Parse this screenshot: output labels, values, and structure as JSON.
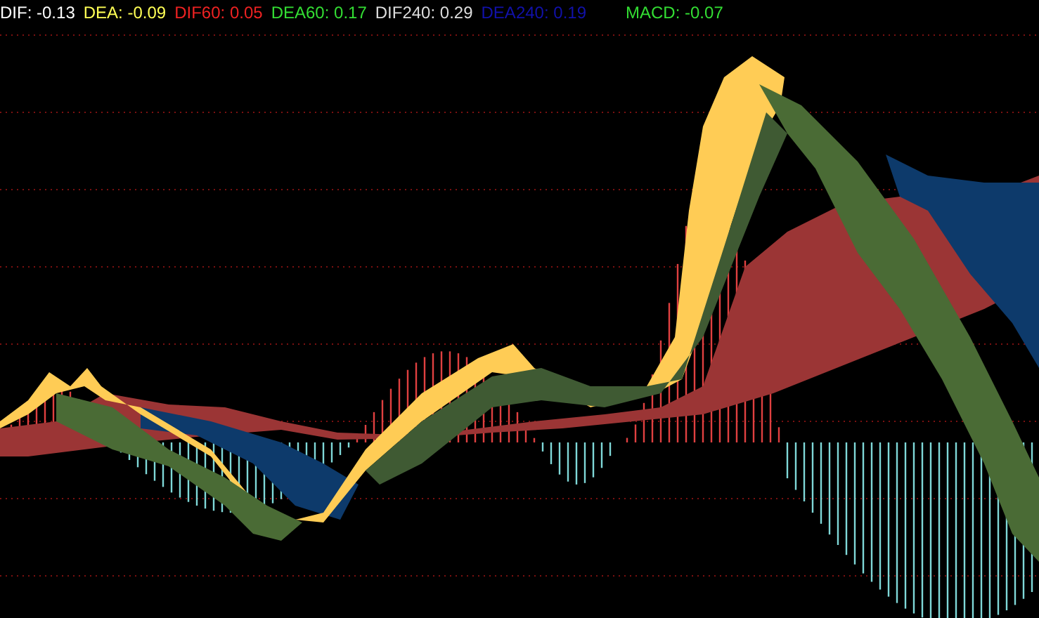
{
  "legend": [
    {
      "label": "DIF:",
      "value": "-0.13",
      "color": "#ffffff"
    },
    {
      "label": "DEA:",
      "value": "-0.09",
      "color": "#ffff55"
    },
    {
      "label": "DIF60:",
      "value": "0.05",
      "color": "#ee2222"
    },
    {
      "label": "DEA60:",
      "value": "0.17",
      "color": "#33dd33"
    },
    {
      "label": "DIF240:",
      "value": "0.29",
      "color": "#dddddd"
    },
    {
      "label": "DEA240:",
      "value": "0.19",
      "color": "#1111aa"
    },
    {
      "label": "MACD:",
      "value": "-0.07",
      "color": "#33dd33"
    }
  ]
}
